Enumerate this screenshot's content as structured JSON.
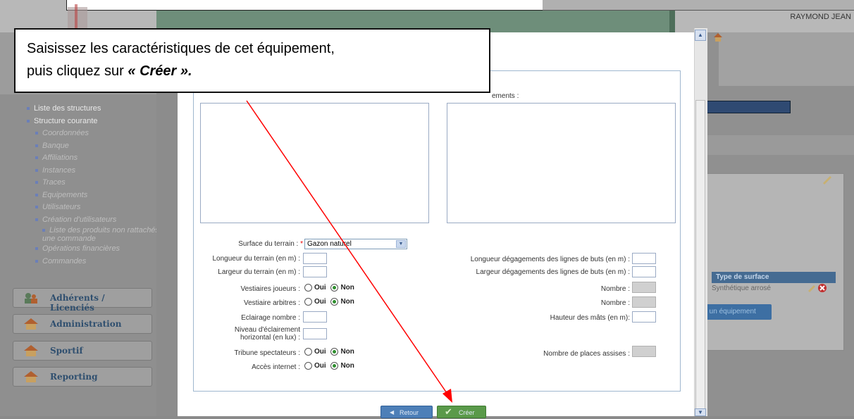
{
  "header": {
    "user_name": "RAYMOND JEAN"
  },
  "sidebar": {
    "items": [
      {
        "label": "Liste des structures",
        "level": 0
      },
      {
        "label": "Structure courante",
        "level": 0
      },
      {
        "label": "Coordonnées",
        "level": 1
      },
      {
        "label": "Banque",
        "level": 1
      },
      {
        "label": "Affiliations",
        "level": 1
      },
      {
        "label": "Instances",
        "level": 1
      },
      {
        "label": "Traces",
        "level": 1
      },
      {
        "label": "Equipements",
        "level": 1
      },
      {
        "label": "Utilisateurs",
        "level": 1
      },
      {
        "label": "Création d'utilisateurs",
        "level": 1
      },
      {
        "label": "Liste des produits non rattachés à une commande",
        "level": 1
      },
      {
        "label": "Opérations financières",
        "level": 1
      },
      {
        "label": "Commandes",
        "level": 1
      }
    ],
    "sections": [
      {
        "label": "Adhérents / Licenciés"
      },
      {
        "label": "Administration"
      },
      {
        "label": "Sportif"
      },
      {
        "label": "Reporting"
      }
    ]
  },
  "background_panel": {
    "table_header": "Type de surface",
    "table_cell": "Synthétique arrosé",
    "add_button": "er un équipement"
  },
  "callout": {
    "line1": "Saisissez les caractéristiques de cet équipement,",
    "line2_prefix": "puis cliquez sur ",
    "line2_bold": "« Créer ».",
    "partial_label": "ements :"
  },
  "form": {
    "surface": {
      "label": "Surface du terrain :",
      "required_mark": "*",
      "value": "Gazon naturel"
    },
    "left_fields": {
      "longueur": "Longueur du terrain (en m) :",
      "largeur": "Largeur du terrain (en m) :",
      "vestiaires_joueurs": "Vestiaires joueurs :",
      "vestiaire_arbitres": "Vestiaire arbitres :",
      "eclairage": "Eclairage nombre :",
      "niveau_line1": "Niveau d'éclairement",
      "niveau_line2": "horizontal (en lux) :",
      "tribune": "Tribune spectateurs :",
      "acces_internet": "Accès internet :"
    },
    "right_fields": {
      "longueur_degag": "Longueur dégagements des lignes de buts (en m) :",
      "largeur_degag": "Largeur dégagements des lignes de buts (en m) :",
      "nombre1": "Nombre :",
      "nombre2": "Nombre :",
      "hauteur_mats": "Hauteur des mâts (en m):",
      "places_assises": "Nombre de places assises :"
    },
    "radio_oui": "Oui",
    "radio_non": "Non",
    "radio_selected": "Non"
  },
  "buttons": {
    "back": "Retour",
    "create": "Créer"
  },
  "colors": {
    "arrow": "#ff0000",
    "selected_radio": "#2f8f2f"
  }
}
